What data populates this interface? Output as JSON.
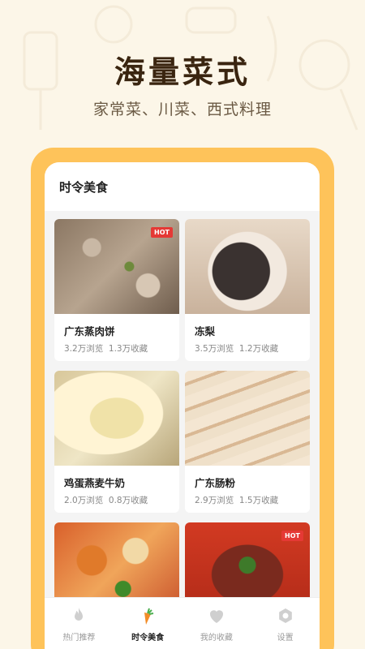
{
  "promo": {
    "headline": "海量菜式",
    "subline": "家常菜、川菜、西式料理"
  },
  "app": {
    "section_title": "时令美食",
    "dishes": [
      {
        "name": "广东蒸肉饼",
        "views": "3.2万浏览",
        "favorites": "1.3万收藏",
        "hot": true,
        "hot_label": "HOT"
      },
      {
        "name": "冻梨",
        "views": "3.5万浏览",
        "favorites": "1.2万收藏",
        "hot": false
      },
      {
        "name": "鸡蛋燕麦牛奶",
        "views": "2.0万浏览",
        "favorites": "0.8万收藏",
        "hot": false
      },
      {
        "name": "广东肠粉",
        "views": "2.9万浏览",
        "favorites": "1.5万收藏",
        "hot": false
      },
      {
        "name": "",
        "views": "",
        "favorites": "",
        "hot": false
      },
      {
        "name": "",
        "views": "",
        "favorites": "",
        "hot": true,
        "hot_label": "HOT"
      }
    ],
    "tabs": [
      {
        "label": "热门推荐",
        "icon": "flame-icon",
        "active": false
      },
      {
        "label": "时令美食",
        "icon": "carrot-icon",
        "active": true
      },
      {
        "label": "我的收藏",
        "icon": "heart-icon",
        "active": false
      },
      {
        "label": "设置",
        "icon": "gear-icon",
        "active": false
      }
    ]
  },
  "colors": {
    "background": "#FCF6E8",
    "phone_frame": "#FEC35A",
    "hot_badge": "#E53935",
    "active_icon": "#F28C28"
  }
}
